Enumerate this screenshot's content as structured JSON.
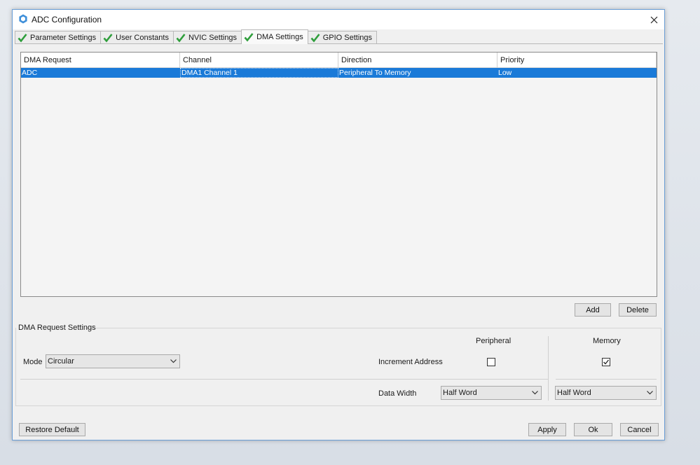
{
  "window": {
    "title": "ADC Configuration"
  },
  "tabs": [
    {
      "label": "Parameter Settings",
      "checked": true,
      "active": false
    },
    {
      "label": "User Constants",
      "checked": true,
      "active": false
    },
    {
      "label": "NVIC Settings",
      "checked": true,
      "active": false
    },
    {
      "label": "DMA Settings",
      "checked": true,
      "active": true
    },
    {
      "label": "GPIO Settings",
      "checked": true,
      "active": false
    }
  ],
  "table": {
    "columns": [
      "DMA Request",
      "Channel",
      "Direction",
      "Priority"
    ],
    "rows": [
      {
        "request": "ADC",
        "channel": "DMA1 Channel 1",
        "direction": "Peripheral To Memory",
        "priority": "Low",
        "selected": true
      }
    ]
  },
  "table_buttons": {
    "add": "Add",
    "delete": "Delete"
  },
  "settings": {
    "group_title": "DMA Request Settings",
    "peripheral_header": "Peripheral",
    "memory_header": "Memory",
    "mode_label": "Mode",
    "mode_value": "Circular",
    "increment_label": "Increment Address",
    "peripheral_increment": false,
    "memory_increment": true,
    "data_width_label": "Data Width",
    "peripheral_width": "Half Word",
    "memory_width": "Half Word"
  },
  "footer": {
    "restore": "Restore Default",
    "apply": "Apply",
    "ok": "Ok",
    "cancel": "Cancel"
  },
  "colors": {
    "selection": "#1a7ad8",
    "check_green": "#2e9e3b",
    "window_border": "#6a9ed6"
  }
}
